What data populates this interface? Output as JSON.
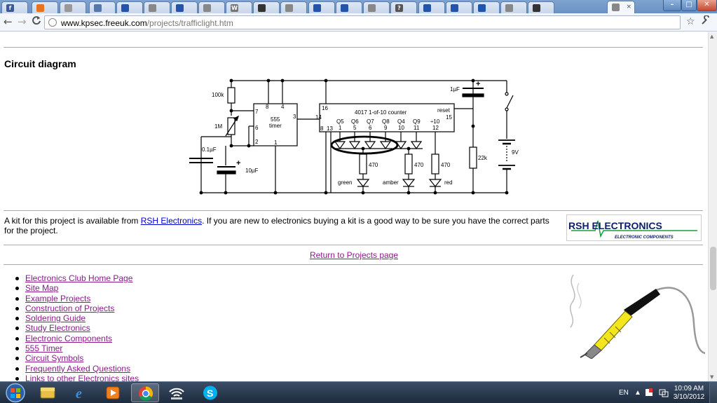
{
  "tabs": [
    {
      "label": "f",
      "favicon_color": "#3b5998",
      "active": false
    },
    {
      "label": "",
      "favicon_color": "#e8731c",
      "active": false
    },
    {
      "label": "",
      "favicon_color": "#999999",
      "active": false
    },
    {
      "label": "",
      "favicon_color": "#5577aa",
      "active": false
    },
    {
      "label": "",
      "favicon_color": "#2255aa",
      "active": false
    },
    {
      "label": "",
      "favicon_color": "#888888",
      "active": false
    },
    {
      "label": "",
      "favicon_color": "#2255aa",
      "active": false
    },
    {
      "label": "",
      "favicon_color": "#888888",
      "active": false
    },
    {
      "label": "W",
      "favicon_color": "#777777",
      "active": false
    },
    {
      "label": "",
      "favicon_color": "#333333",
      "active": false
    },
    {
      "label": "",
      "favicon_color": "#888888",
      "active": false
    },
    {
      "label": "",
      "favicon_color": "#2255aa",
      "active": false
    },
    {
      "label": "",
      "favicon_color": "#2255aa",
      "active": false
    },
    {
      "label": "",
      "favicon_color": "#888888",
      "active": false
    },
    {
      "label": "?",
      "favicon_color": "#555555",
      "active": false
    },
    {
      "label": "",
      "favicon_color": "#2255aa",
      "active": false
    },
    {
      "label": "",
      "favicon_color": "#2255aa",
      "active": false
    },
    {
      "label": "",
      "favicon_color": "#2255aa",
      "active": false
    },
    {
      "label": "",
      "favicon_color": "#888888",
      "active": false
    },
    {
      "label": "",
      "favicon_color": "#333333",
      "active": false
    },
    {
      "label": "",
      "favicon_color": "#888888",
      "active": true
    }
  ],
  "toolbar": {
    "back_icon": "←",
    "forward_icon": "→",
    "reload_icon": "C",
    "url_host": "www.kpsec.freeuk.com",
    "url_path": "/projects/trafficlight.htm",
    "star_icon": "☆",
    "wrench_icon": "🔧"
  },
  "page": {
    "heading": "Circuit diagram",
    "kit_text_before": "A kit for this project is available from ",
    "kit_link": "RSH Electronics",
    "kit_text_after": ". If you are new to electronics buying a kit is a good way to be sure you have the correct parts for the project.",
    "logo_main": "RSH ELECTRONICS",
    "logo_sub": "ELECTRONIC COMPONENTS",
    "return_link": "Return to Projects page",
    "nav_links": [
      "Electronics Club Home Page",
      "Site Map",
      "Example Projects",
      "Construction of Projects",
      "Soldering Guide",
      "Study Electronics",
      "Electronic Components",
      "555 Timer",
      "Circuit Symbols",
      "Frequently Asked Questions",
      "Links to other Electronics sites"
    ]
  },
  "circuit": {
    "r_100k": "100k",
    "r_1m": "1M",
    "c_01uf": "0.1µF",
    "c_10uf": "10µF",
    "c_1uf": "1µF",
    "r_22k": "22k",
    "battery": "9V",
    "chip_555": "555",
    "chip_555_sub": "timer",
    "chip_4017": "4017 1-of-10 counter",
    "reset": "reset",
    "pin_8": "8",
    "pin_4": "4",
    "pin_7": "7",
    "pin_6": "6",
    "pin_2": "2",
    "pin_1": "1",
    "pin_3": "3",
    "pin_16": "16",
    "pin_14": "14",
    "pin_15": "15",
    "pin_8b": "8",
    "pin_13": "13",
    "outputs": [
      "Q5",
      "Q6",
      "Q7",
      "Q8",
      "Q4",
      "Q9",
      "÷10"
    ],
    "output_pins": [
      "1",
      "5",
      "6",
      "9",
      "10",
      "11",
      "12"
    ],
    "r_470a": "470",
    "r_470b": "470",
    "r_470c": "470",
    "led_green": "green",
    "led_amber": "amber",
    "led_red": "red"
  },
  "taskbar": {
    "lang": "EN",
    "time": "10:09 AM",
    "date": "3/10/2012"
  }
}
